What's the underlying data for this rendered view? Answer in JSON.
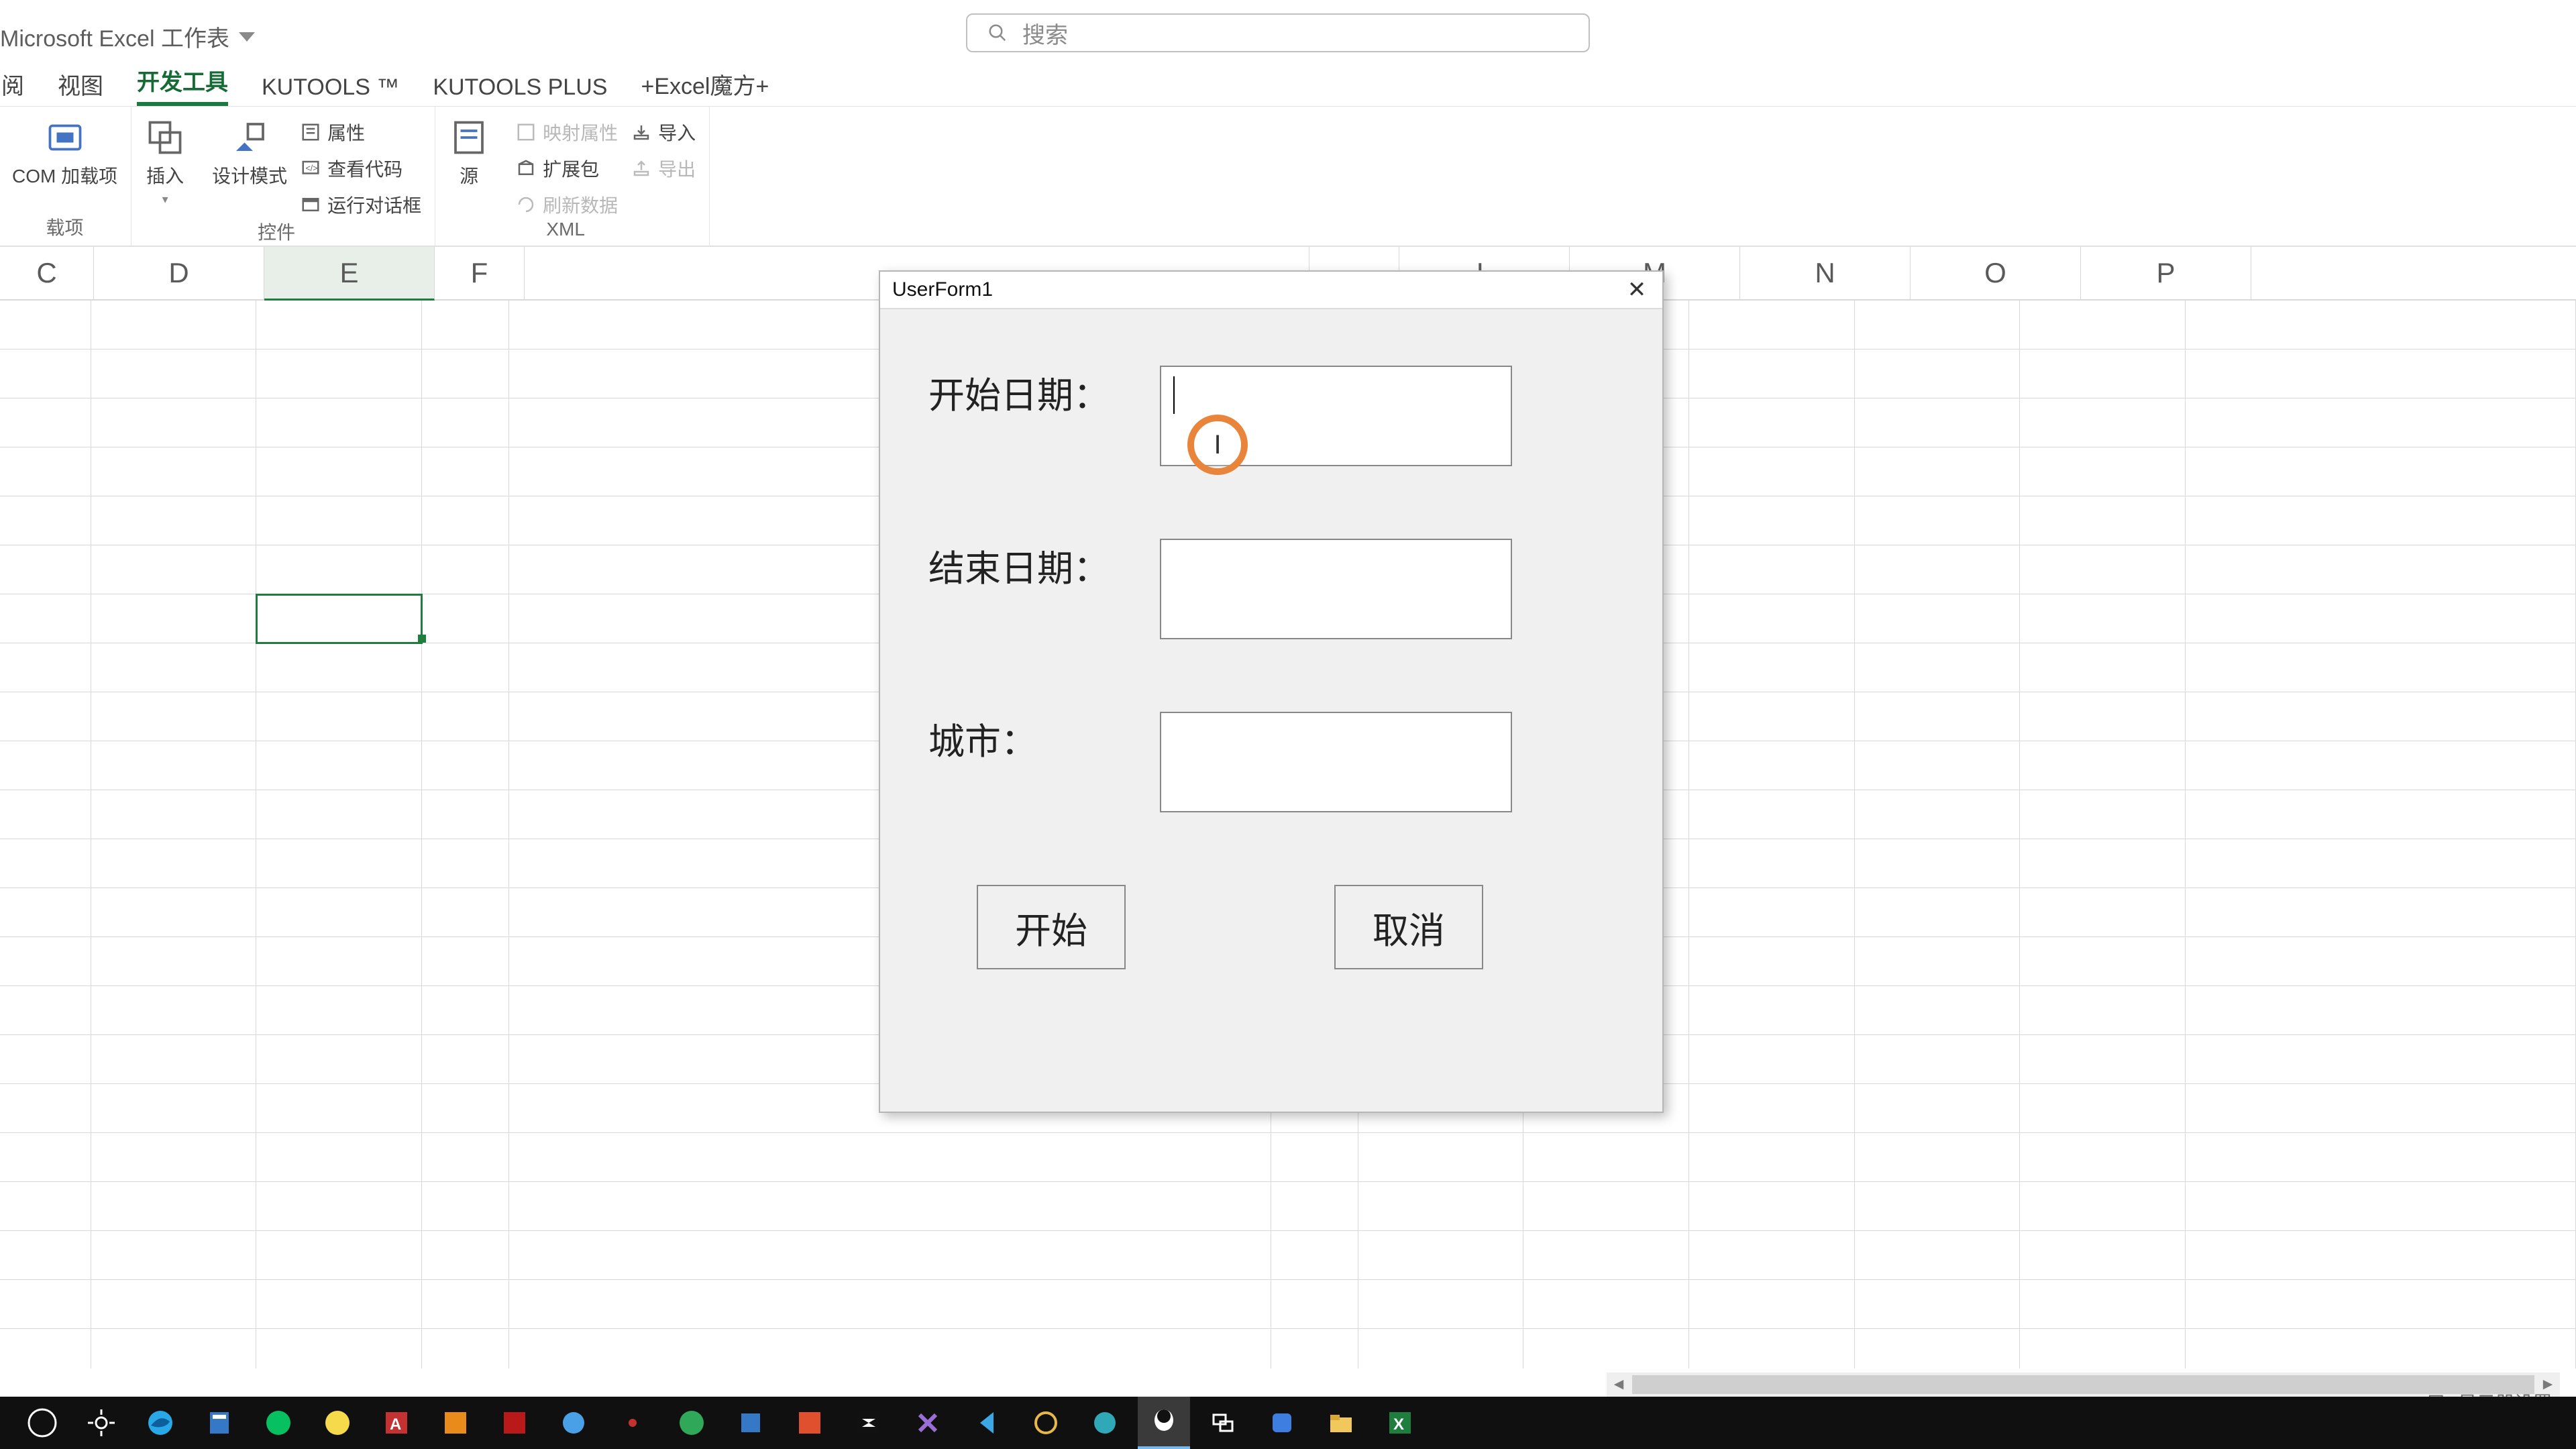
{
  "app": {
    "title": "Microsoft Excel 工作表",
    "search_placeholder": "搜索"
  },
  "tabs": {
    "t0": "阅",
    "t1": "视图",
    "t2": "开发工具",
    "t3": "KUTOOLS ™",
    "t4": "KUTOOLS PLUS",
    "t5": "+Excel魔方+"
  },
  "ribbon": {
    "addins_group": "载项",
    "com_addins": "COM 加载项",
    "insert": "插入",
    "design_mode": "设计模式",
    "properties": "属性",
    "view_code": "查看代码",
    "run_dialog": "运行对话框",
    "controls_group": "控件",
    "source": "源",
    "map_properties": "映射属性",
    "expansion": "扩展包",
    "refresh": "刷新数据",
    "import": "导入",
    "export": "导出",
    "xml_group": "XML"
  },
  "columns": [
    "C",
    "D",
    "E",
    "F",
    "",
    "",
    "",
    "",
    "",
    "L",
    "M",
    "N",
    "O",
    "P"
  ],
  "userform": {
    "title": "UserForm1",
    "start_date": "开始日期：",
    "end_date": "结束日期：",
    "city": "城市：",
    "start_btn": "开始",
    "cancel_btn": "取消"
  },
  "status": {
    "display_settings": "显示器设置"
  },
  "cursor_marker": "I"
}
